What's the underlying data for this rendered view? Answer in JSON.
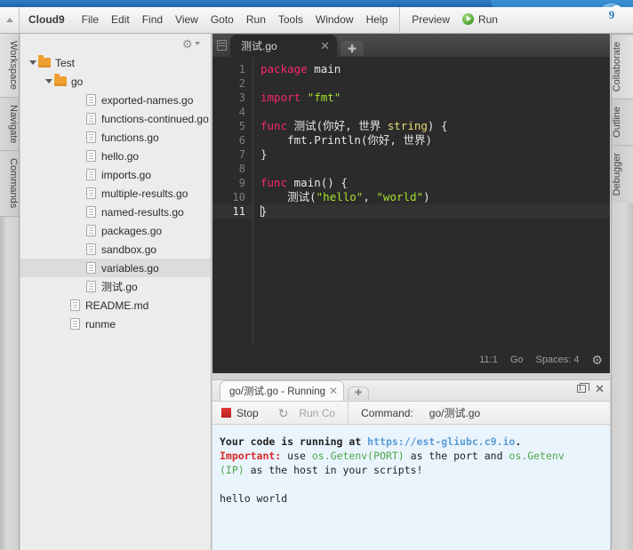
{
  "banner": {
    "logo_text": "9",
    "logo_icon": "cloud9-logo-icon"
  },
  "menubar": {
    "collapse_icon": "caret-down-icon",
    "brand": "Cloud9",
    "items": [
      "File",
      "Edit",
      "Find",
      "View",
      "Goto",
      "Run",
      "Tools",
      "Window",
      "Help"
    ],
    "preview": "Preview",
    "run": "Run",
    "run_icon": "play-circle-icon"
  },
  "left_rail": {
    "tabs": [
      "Workspace",
      "Navigate",
      "Commands"
    ]
  },
  "right_rail": {
    "tabs": [
      "Collaborate",
      "Outline",
      "Debugger"
    ]
  },
  "filetree": {
    "gear_icon": "gear-icon",
    "caret_icon": "caret-down-icon",
    "rows": [
      {
        "label": "Test",
        "type": "folder",
        "indent": 0,
        "twisty": true,
        "selected": false
      },
      {
        "label": "go",
        "type": "folder",
        "indent": 1,
        "twisty": true,
        "selected": false
      },
      {
        "label": "exported-names.go",
        "type": "file",
        "indent": 3,
        "twisty": false,
        "selected": false
      },
      {
        "label": "functions-continued.go",
        "type": "file",
        "indent": 3,
        "twisty": false,
        "selected": false
      },
      {
        "label": "functions.go",
        "type": "file",
        "indent": 3,
        "twisty": false,
        "selected": false
      },
      {
        "label": "hello.go",
        "type": "file",
        "indent": 3,
        "twisty": false,
        "selected": false
      },
      {
        "label": "imports.go",
        "type": "file",
        "indent": 3,
        "twisty": false,
        "selected": false
      },
      {
        "label": "multiple-results.go",
        "type": "file",
        "indent": 3,
        "twisty": false,
        "selected": false
      },
      {
        "label": "named-results.go",
        "type": "file",
        "indent": 3,
        "twisty": false,
        "selected": false
      },
      {
        "label": "packages.go",
        "type": "file",
        "indent": 3,
        "twisty": false,
        "selected": false
      },
      {
        "label": "sandbox.go",
        "type": "file",
        "indent": 3,
        "twisty": false,
        "selected": false
      },
      {
        "label": "variables.go",
        "type": "file",
        "indent": 3,
        "twisty": false,
        "selected": true
      },
      {
        "label": "测试.go",
        "type": "file",
        "indent": 3,
        "twisty": false,
        "selected": false
      },
      {
        "label": "README.md",
        "type": "file",
        "indent": 2,
        "twisty": false,
        "selected": false
      },
      {
        "label": "runme",
        "type": "file",
        "indent": 2,
        "twisty": false,
        "selected": false
      }
    ]
  },
  "editor": {
    "side_icon": "panel-toggle-icon",
    "tab_label": "测试.go",
    "tab_close_icon": "close-icon",
    "new_tab_icon": "plus-icon",
    "line_numbers": [
      "1",
      "2",
      "3",
      "4",
      "5",
      "6",
      "7",
      "8",
      "9",
      "10",
      "11"
    ],
    "active_line": 11,
    "lines": [
      [
        {
          "t": "package",
          "c": "k"
        },
        {
          "t": " main",
          "c": "fn"
        }
      ],
      [],
      [
        {
          "t": "import",
          "c": "k"
        },
        {
          "t": " ",
          "c": "pl"
        },
        {
          "t": "\"fmt\"",
          "c": "s"
        }
      ],
      [],
      [
        {
          "t": "func",
          "c": "k"
        },
        {
          "t": " 测试(你好, 世界 ",
          "c": "fn"
        },
        {
          "t": "string",
          "c": "t"
        },
        {
          "t": ") {",
          "c": "pl"
        }
      ],
      [
        {
          "t": "    fmt.Println(你好, 世界)",
          "c": "pl"
        }
      ],
      [
        {
          "t": "}",
          "c": "pl"
        }
      ],
      [],
      [
        {
          "t": "func",
          "c": "k"
        },
        {
          "t": " main() {",
          "c": "fn"
        }
      ],
      [
        {
          "t": "    测试(",
          "c": "pl"
        },
        {
          "t": "\"hello\"",
          "c": "s"
        },
        {
          "t": ", ",
          "c": "pl"
        },
        {
          "t": "\"world\"",
          "c": "s"
        },
        {
          "t": ")",
          "c": "pl"
        }
      ],
      [
        {
          "t": "}",
          "c": "pl"
        }
      ]
    ],
    "status": {
      "cursor": "11:1",
      "language": "Go",
      "indent": "Spaces: 4",
      "gear_icon": "gear-icon"
    }
  },
  "console": {
    "tab_label": "go/测试.go - Running",
    "tab_close_icon": "close-icon",
    "new_tab_icon": "plus-icon",
    "restore_icon": "restore-window-icon",
    "close_icon": "close-icon",
    "stop_label": "Stop",
    "stop_icon": "stop-square-icon",
    "refresh_icon": "refresh-icon",
    "run_config_label": "Run Co",
    "command_label": "Command:",
    "command_value": "go/测试.go",
    "output": {
      "line1_a": "Your code is running at ",
      "line1_url": "https://est-gliubc.c9.io",
      "line1_b": ".",
      "line2_important": "Important:",
      "line2_a": " use ",
      "line2_env1": "os.Getenv(PORT)",
      "line2_b": " as the port and ",
      "line2_env2": "os.Getenv",
      "line3_env": "(IP)",
      "line3_a": " as the host in your scripts!",
      "blank": "",
      "result": "hello world"
    }
  },
  "colors": {
    "banner_blue": "#2e7fc4",
    "editor_bg": "#2b2b2b",
    "keyword": "#f92672",
    "string": "#a6e22e",
    "type": "#e6db74",
    "console_bg": "#eaf4fd",
    "url": "#5b9bd5",
    "important": "#d92b2b",
    "env": "#4da64d",
    "folder": "#f0a030"
  }
}
